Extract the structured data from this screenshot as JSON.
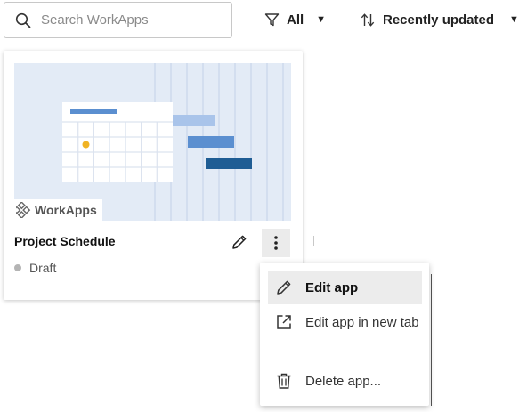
{
  "search": {
    "placeholder": "Search WorkApps",
    "value": ""
  },
  "filter": {
    "label": "All"
  },
  "sort": {
    "label": "Recently updated"
  },
  "card": {
    "brand": "WorkApps",
    "title": "Project Schedule",
    "status": "Draft"
  },
  "menu": {
    "items": [
      {
        "label": "Edit app",
        "icon": "pencil-icon"
      },
      {
        "label": "Edit app in new tab",
        "icon": "external-link-icon"
      },
      {
        "label": "Delete app...",
        "icon": "trash-icon"
      }
    ]
  },
  "colors": {
    "thumbnail_bg": "#e3ebf6",
    "bar_light": "#a9c4ea",
    "bar_mid": "#5b8fd0",
    "bar_dark": "#1f5d94",
    "calendar_dot": "#f0b323",
    "status_dot": "#b4b4b4"
  }
}
